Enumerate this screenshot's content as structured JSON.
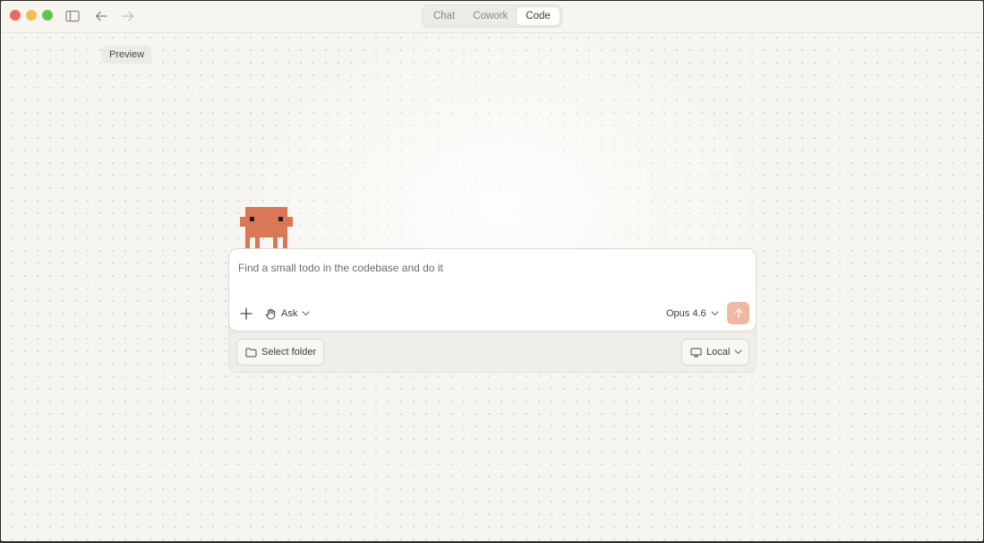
{
  "titlebar": {
    "mode_tabs": [
      {
        "label": "Chat",
        "active": false
      },
      {
        "label": "Cowork",
        "active": false
      },
      {
        "label": "Code",
        "active": true
      }
    ]
  },
  "preview_badge": "Preview",
  "composer": {
    "prompt_text": "Find a small todo in the codebase and do it",
    "ask_label": "Ask",
    "model_label": "Opus 4.6",
    "select_folder_label": "Select folder",
    "environment_label": "Local"
  },
  "colors": {
    "accent": "#d97757",
    "send_button": "#f0b7a2",
    "background": "#f6f5f0"
  }
}
